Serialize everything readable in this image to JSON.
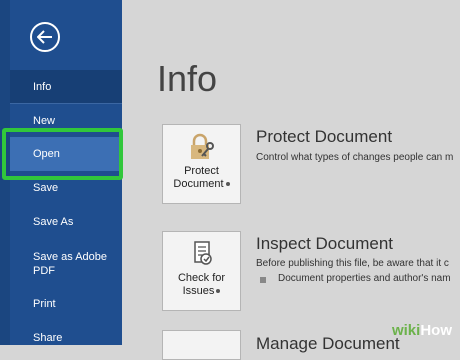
{
  "sidebar": {
    "items": [
      {
        "label": "Info"
      },
      {
        "label": "New"
      },
      {
        "label": "Open"
      },
      {
        "label": "Save"
      },
      {
        "label": "Save As"
      },
      {
        "label": "Save as Adobe PDF"
      },
      {
        "label": "Print"
      },
      {
        "label": "Share"
      }
    ]
  },
  "main": {
    "title": "Info",
    "protect": {
      "button_line1": "Protect",
      "button_line2": "Document",
      "heading": "Protect Document",
      "description": "Control what types of changes people can m"
    },
    "inspect": {
      "button_line1": "Check for",
      "button_line2": "Issues",
      "heading": "Inspect Document",
      "description": "Before publishing this file, be aware that it c",
      "bullet": "Document properties and author's nam"
    },
    "manage": {
      "heading": "Manage Document"
    }
  },
  "watermark": {
    "wiki": "wiki",
    "how": "How"
  },
  "colors": {
    "sidebar": "#1f4e8f",
    "highlight": "#31c73b",
    "selected": "#3c6fb4"
  }
}
